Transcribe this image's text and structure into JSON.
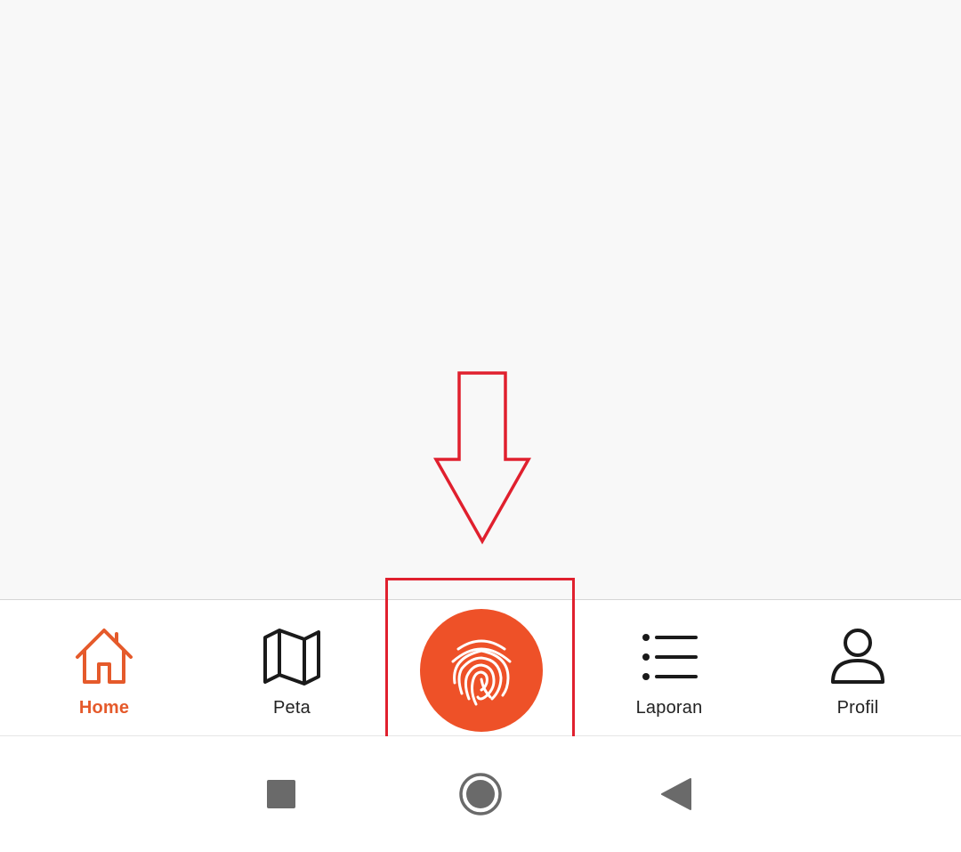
{
  "bottom_nav": {
    "items": [
      {
        "label": "Home",
        "icon": "home-icon",
        "active": true
      },
      {
        "label": "Peta",
        "icon": "map-icon",
        "active": false
      },
      {
        "label": "",
        "icon": "fingerprint-icon",
        "active": false
      },
      {
        "label": "Laporan",
        "icon": "list-icon",
        "active": false
      },
      {
        "label": "Profil",
        "icon": "person-icon",
        "active": false
      }
    ],
    "active_color": "#e55a2b",
    "fab_color": "#ee5128"
  },
  "annotation": {
    "color": "#e0202e"
  },
  "system_nav": {
    "buttons": [
      "recent-apps-icon",
      "home-circle-icon",
      "back-triangle-icon"
    ]
  }
}
